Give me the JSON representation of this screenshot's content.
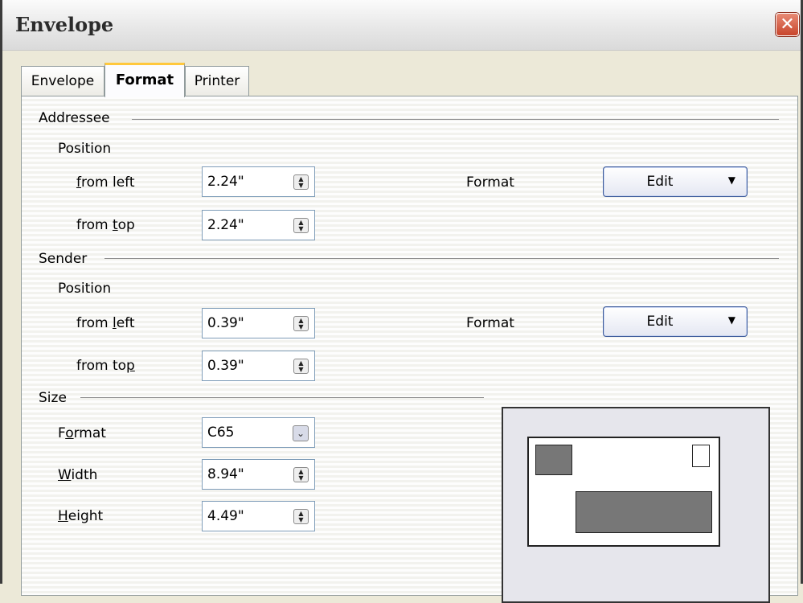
{
  "window": {
    "title": "Envelope"
  },
  "tabs": [
    {
      "label": "Envelope"
    },
    {
      "label": "Format"
    },
    {
      "label": "Printer"
    }
  ],
  "addressee": {
    "heading": "Addressee",
    "position_label": "Position",
    "from_left": {
      "label_pre": "",
      "label_u": "f",
      "label_post": "rom left",
      "value": "2.24\""
    },
    "from_top": {
      "label_pre": "from ",
      "label_u": "t",
      "label_post": "op",
      "value": "2.24\""
    },
    "format_label": "Format",
    "edit_label": "Edit"
  },
  "sender": {
    "heading": "Sender",
    "position_label": "Position",
    "from_left": {
      "label_pre": "from ",
      "label_u": "l",
      "label_post": "eft",
      "value": "0.39\""
    },
    "from_top": {
      "label_pre": "from to",
      "label_u": "p",
      "label_post": "",
      "value": "0.39\""
    },
    "format_label": "Format",
    "edit_label": "Edit"
  },
  "size": {
    "heading": "Size",
    "format": {
      "label_pre": "F",
      "label_u": "o",
      "label_post": "rmat",
      "value": "C65"
    },
    "width": {
      "label_pre": "",
      "label_u": "W",
      "label_post": "idth",
      "value": "8.94\""
    },
    "height": {
      "label_pre": "",
      "label_u": "H",
      "label_post": "eight",
      "value": "4.49\""
    }
  },
  "icons": {
    "close": "close-icon",
    "spin": "spin-arrows-icon",
    "dropdown": "chevron-down-icon"
  },
  "colors": {
    "tab_highlight": "#ffc83c",
    "close_button": "#c8452c",
    "preview_block": "#777777"
  }
}
